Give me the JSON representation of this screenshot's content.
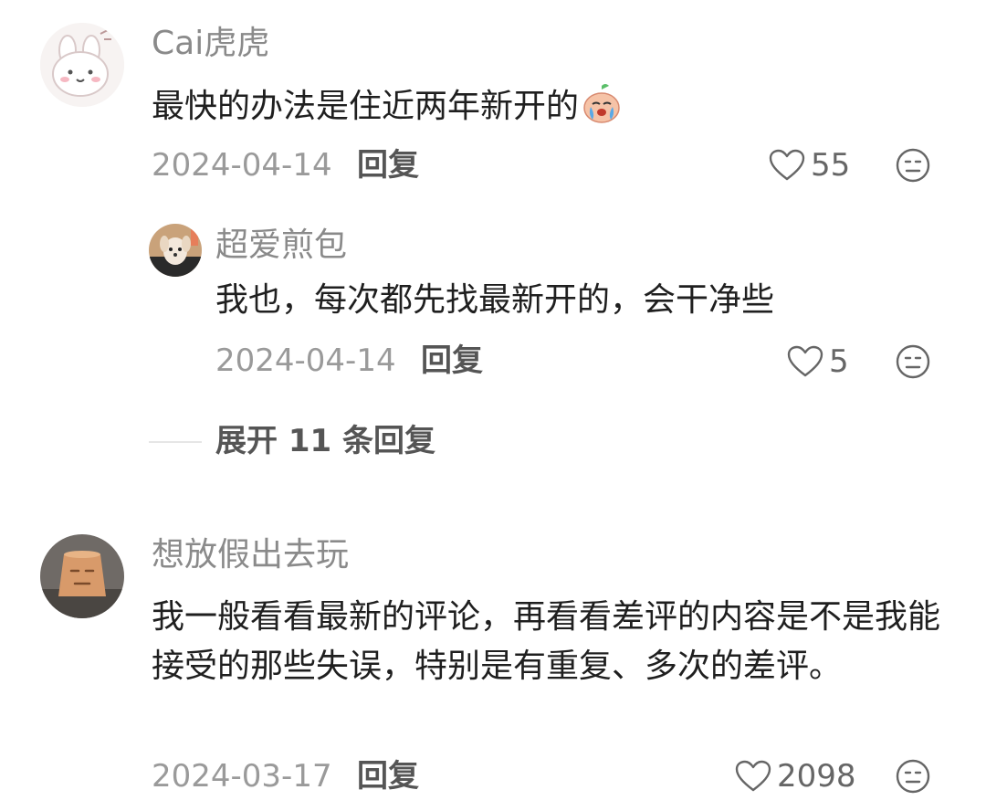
{
  "comments": [
    {
      "username": "Cai虎虎",
      "avatar_icon": "bunny-avatar",
      "content": "最快的办法是住近两年新开的",
      "emoji_icon": "crying-face-emoji",
      "date": "2024-04-14",
      "reply_label": "回复",
      "likes": "55"
    },
    {
      "username": "想放假出去玩",
      "avatar_icon": "clay-pot-face-avatar",
      "content": "我一般看看最新的评论，再看看差评的内容是不是我能接受的那些失误，特别是有重复、多次的差评。",
      "date": "2024-03-17",
      "reply_label": "回复",
      "likes": "2098"
    }
  ],
  "reply": {
    "username": "超爱煎包",
    "avatar_icon": "dog-photo-avatar",
    "content": "我也，每次都先找最新开的，会干净些",
    "date": "2024-04-14",
    "reply_label": "回复",
    "likes": "5"
  },
  "expand": {
    "label": "展开 11 条回复"
  },
  "icons": {
    "like": "heart-outline-icon",
    "dislike": "neutral-face-icon"
  },
  "colors": {
    "username": "#8a8a8a",
    "text": "#1f1f1f",
    "meta": "#9a9a9a"
  }
}
